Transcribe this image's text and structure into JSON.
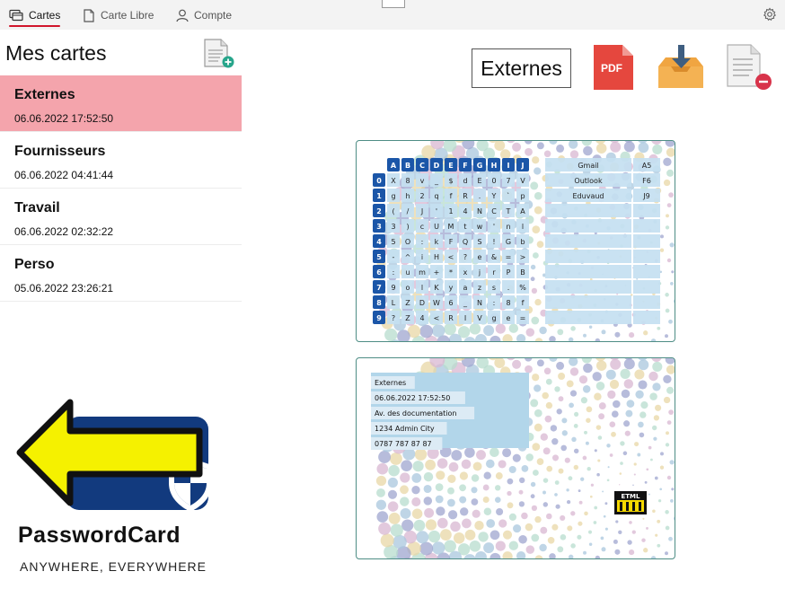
{
  "nav": {
    "tabs": [
      {
        "label": "Cartes",
        "icon": "cards-icon",
        "active": true
      },
      {
        "label": "Carte Libre",
        "icon": "document-icon",
        "active": false
      },
      {
        "label": "Compte",
        "icon": "person-icon",
        "active": false
      }
    ],
    "settings_icon": "gear-icon"
  },
  "sidebar": {
    "title": "Mes cartes",
    "new_card_icon": "document-add-icon",
    "cards": [
      {
        "name": "Externes",
        "date": "06.06.2022 17:52:50",
        "selected": true
      },
      {
        "name": "Fournisseurs",
        "date": "06.06.2022 04:41:44",
        "selected": false
      },
      {
        "name": "Travail",
        "date": "06.06.2022 02:32:22",
        "selected": false
      },
      {
        "name": "Perso",
        "date": "05.06.2022 23:26:21",
        "selected": false
      }
    ]
  },
  "logo": {
    "wordmark": "PasswordCard",
    "tagline": "ANYWHERE, EVERYWHERE"
  },
  "toolbar": {
    "card_name": "Externes",
    "pdf_label": "PDF",
    "icons": [
      "pdf-icon",
      "download-tray-icon",
      "document-remove-icon"
    ]
  },
  "card_front": {
    "columns": [
      "A",
      "B",
      "C",
      "D",
      "E",
      "F",
      "G",
      "H",
      "I",
      "J"
    ],
    "rows": [
      {
        "key": "0",
        "cells": [
          "X",
          "8",
          "v",
          "_",
          "$",
          "d",
          "E",
          "0",
          "7",
          "V"
        ]
      },
      {
        "key": "1",
        "cells": [
          "g",
          "h",
          "2",
          "q",
          "f",
          "R",
          ".",
          "Y",
          "`",
          "p"
        ]
      },
      {
        "key": "2",
        "cells": [
          "(",
          "/",
          "J",
          "'",
          "1",
          "4",
          "N",
          "C",
          "T",
          "A"
        ]
      },
      {
        "key": "3",
        "cells": [
          "3",
          ")",
          "c",
          "U",
          "M",
          "t",
          "w",
          "'",
          "n",
          "l"
        ]
      },
      {
        "key": "4",
        "cells": [
          "5",
          "O",
          ":",
          "k",
          "F",
          "Q",
          "S",
          "!",
          "G",
          "b"
        ]
      },
      {
        "key": "5",
        "cells": [
          "-",
          "^",
          "i",
          "H",
          "<",
          "?",
          "e",
          "&",
          "=",
          ">"
        ]
      },
      {
        "key": "6",
        "cells": [
          ":",
          "u",
          "m",
          "+",
          "*",
          "x",
          "j",
          "r",
          "P",
          "B"
        ]
      },
      {
        "key": "7",
        "cells": [
          "9",
          "o",
          "l",
          "K",
          "y",
          "a",
          "z",
          "s",
          ".",
          "%"
        ]
      },
      {
        "key": "8",
        "cells": [
          "L",
          "Z",
          "D",
          "W",
          "6",
          "_",
          "N",
          ":",
          "8",
          "f"
        ]
      },
      {
        "key": "9",
        "cells": [
          "?",
          "Z",
          "4",
          "<",
          "R",
          "I",
          "V",
          "g",
          "e",
          "="
        ]
      }
    ],
    "entries": [
      {
        "name": "Gmail",
        "code": "A5"
      },
      {
        "name": "Outlook",
        "code": "F6"
      },
      {
        "name": "Eduvaud",
        "code": "J9"
      }
    ]
  },
  "card_back": {
    "lines": [
      "Externes",
      "06.06.2022 17:52:50",
      "Av. des documentation",
      "1234 Admin City",
      "0787 787 87 87"
    ],
    "emblem": "ETML"
  }
}
